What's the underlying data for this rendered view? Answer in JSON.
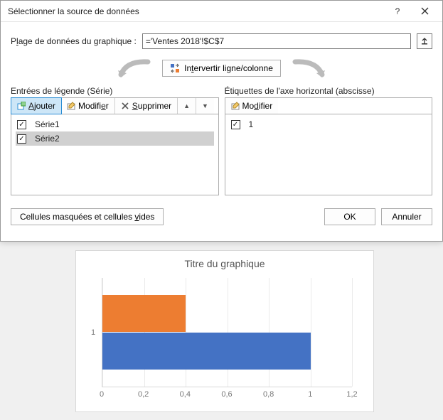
{
  "dialog": {
    "title": "Sélectionner la source de données",
    "range_label_pre": "P",
    "range_label_ul": "l",
    "range_label_post": "age de données du graphique :",
    "range_value": "='Ventes 2018'!$C$7",
    "swap_pre": "In",
    "swap_ul": "t",
    "swap_post": "ervertir ligne/colonne",
    "legend_label": "Entrées de légende (Série)",
    "axis_label": "Étiquettes de l'axe horizontal (abscisse)",
    "buttons": {
      "add_ul": "A",
      "add_post": "jouter",
      "mod_pre": "Modifi",
      "mod_ul": "e",
      "mod_post": "r",
      "del_ul": "S",
      "del_post": "upprimer",
      "mod2_pre": "Mo",
      "mod2_ul": "d",
      "mod2_post": "ifier"
    },
    "series": [
      {
        "label": "Série1",
        "checked": true,
        "selected": false
      },
      {
        "label": "Série2",
        "checked": true,
        "selected": true
      }
    ],
    "categories": [
      {
        "label": "1",
        "checked": true
      }
    ],
    "hidden_cells_pre": "Cellules masquées et cellules ",
    "hidden_cells_ul": "v",
    "hidden_cells_post": "ides",
    "ok": "OK",
    "cancel": "Annuler"
  },
  "chart_data": {
    "type": "bar",
    "orientation": "horizontal",
    "title": "Titre du graphique",
    "categories": [
      "1"
    ],
    "series": [
      {
        "name": "Série1",
        "values": [
          1.0
        ],
        "color": "#4472c4"
      },
      {
        "name": "Série2",
        "values": [
          0.4
        ],
        "color": "#ed7d31"
      }
    ],
    "xlabel": "",
    "ylabel": "",
    "xlim": [
      0,
      1.2
    ],
    "xticks": [
      0,
      0.2,
      0.4,
      0.6,
      0.8,
      1.0,
      1.2
    ],
    "xtick_labels": [
      "0",
      "0,2",
      "0,4",
      "0,6",
      "0,8",
      "1",
      "1,2"
    ]
  }
}
